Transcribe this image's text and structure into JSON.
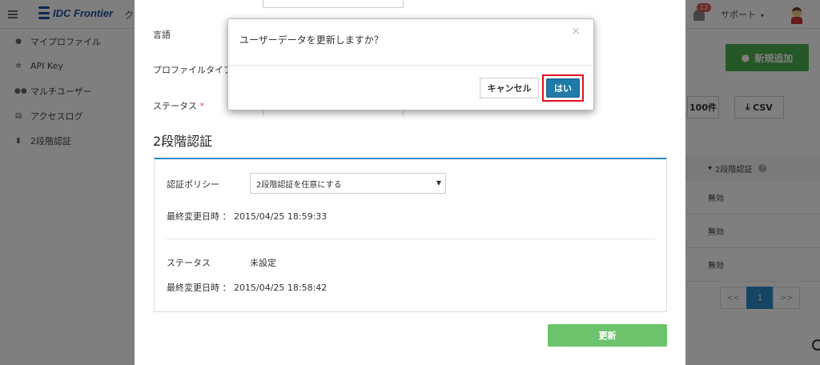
{
  "header": {
    "logo_text": "IDC Frontier",
    "menu_partial": "ク",
    "notification_count": "12",
    "support_label": "サポート",
    "support_caret": "▾"
  },
  "sidebar": {
    "items": [
      {
        "label": "マイプロファイル",
        "icon": "user-icon",
        "glyph": "●"
      },
      {
        "label": "API Key",
        "icon": "gears-icon",
        "glyph": "✲"
      },
      {
        "label": "マルチユーザー",
        "icon": "users-icon",
        "glyph": "●●"
      },
      {
        "label": "アクセスログ",
        "icon": "document-icon",
        "glyph": "▤"
      },
      {
        "label": "2段階認証",
        "icon": "lock-icon",
        "glyph": "▮"
      }
    ]
  },
  "right_panel": {
    "new_button": "新規追加",
    "per_page_button": "100件",
    "csv_button": "CSV",
    "column_header": "2段階認証",
    "sort_icon": "▾",
    "rows": [
      "無効",
      "無効",
      "無効"
    ],
    "pager": {
      "prev": "<<",
      "page": "1",
      "next": ">>"
    }
  },
  "modal": {
    "language_label": "言語",
    "profile_type_label": "プロファイルタイプ",
    "status_label": "ステータス",
    "required_mark": "*",
    "section_title": "2段階認証",
    "policy_label": "認証ポリシー",
    "policy_value": "2段階認証を任意にする",
    "select_caret": "▼",
    "last_modified_1": "最終変更日時 ： 2015/04/25 18:59:33",
    "status2_label": "ステータス",
    "status2_value": "未設定",
    "last_modified_2": "最終変更日時 ： 2015/04/25 18:58:42",
    "update_button": "更新"
  },
  "dialog": {
    "message": "ユーザーデータを更新しますか？",
    "close": "×",
    "cancel_button": "キャンセル",
    "yes_button": "はい"
  }
}
